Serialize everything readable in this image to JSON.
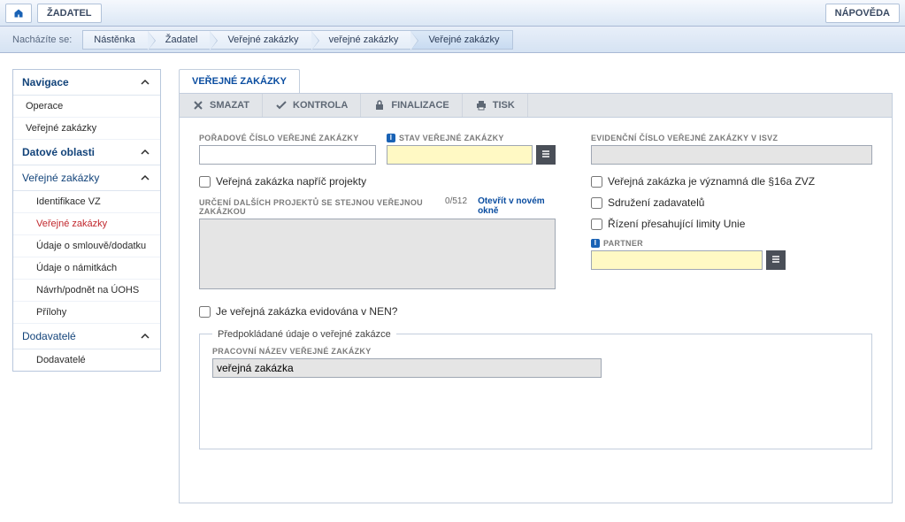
{
  "topbar": {
    "zadatel": "ŽADATEL",
    "napoveda": "NÁPOVĚDA"
  },
  "breadcrumb": {
    "prefix": "Nacházíte se:",
    "items": [
      "Nástěnka",
      "Žadatel",
      "Veřejné zakázky",
      "veřejné zakázky",
      "Veřejné zakázky"
    ]
  },
  "nav": {
    "navigace": "Navigace",
    "operace": "Operace",
    "verejne_zakazky_top": "Veřejné zakázky",
    "datove_oblasti": "Datové oblasti",
    "verejne_zakazky": "Veřejné zakázky",
    "identifikace_vz": "Identifikace VZ",
    "verejne_zakazky_sub": "Veřejné zakázky",
    "udaje_smlouva": "Údaje o smlouvě/dodatku",
    "udaje_namitky": "Údaje o námitkách",
    "navrh_uohs": "Návrh/podnět na ÚOHS",
    "prilohy": "Přílohy",
    "dodavatele": "Dodavatelé",
    "dodavatele_sub": "Dodavatelé"
  },
  "tab": {
    "label": "VEŘEJNÉ ZAKÁZKY"
  },
  "toolbar": {
    "smazat": "SMAZAT",
    "kontrola": "KONTROLA",
    "finalizace": "FINALIZACE",
    "tisk": "TISK"
  },
  "form": {
    "poradove_label": "POŘADOVÉ ČÍSLO VEŘEJNÉ ZAKÁZKY",
    "poradove_value": "",
    "stav_label": "STAV VEŘEJNÉ ZAKÁZKY",
    "stav_value": "",
    "evidencni_label": "EVIDENČNÍ ČÍSLO VEŘEJNÉ ZAKÁZKY V ISVZ",
    "evidencni_value": "",
    "zakazka_napric": "Veřejná zakázka napříč projekty",
    "zakazka_vyznamna": "Veřejná zakázka je významná dle §16a ZVZ",
    "urceni_label": "URČENÍ DALŠÍCH PROJEKTŮ SE STEJNOU VEŘEJNOU ZAKÁZKOU",
    "urceni_count": "0/512",
    "urceni_link": "Otevřít v novém okně",
    "urceni_value": "",
    "sdruzeni": "Sdružení zadavatelů",
    "rizeni_unie": "Řízení přesahující limity Unie",
    "partner_label": "PARTNER",
    "partner_value": "",
    "evidovana_nen": "Je veřejná zakázka evidována v NEN?",
    "fieldset_legend": "Předpokládané údaje o veřejné zakázce",
    "pracovni_nazev_label": "PRACOVNÍ NÁZEV VEŘEJNÉ ZAKÁZKY",
    "pracovni_nazev_value": "veřejná zakázka"
  }
}
